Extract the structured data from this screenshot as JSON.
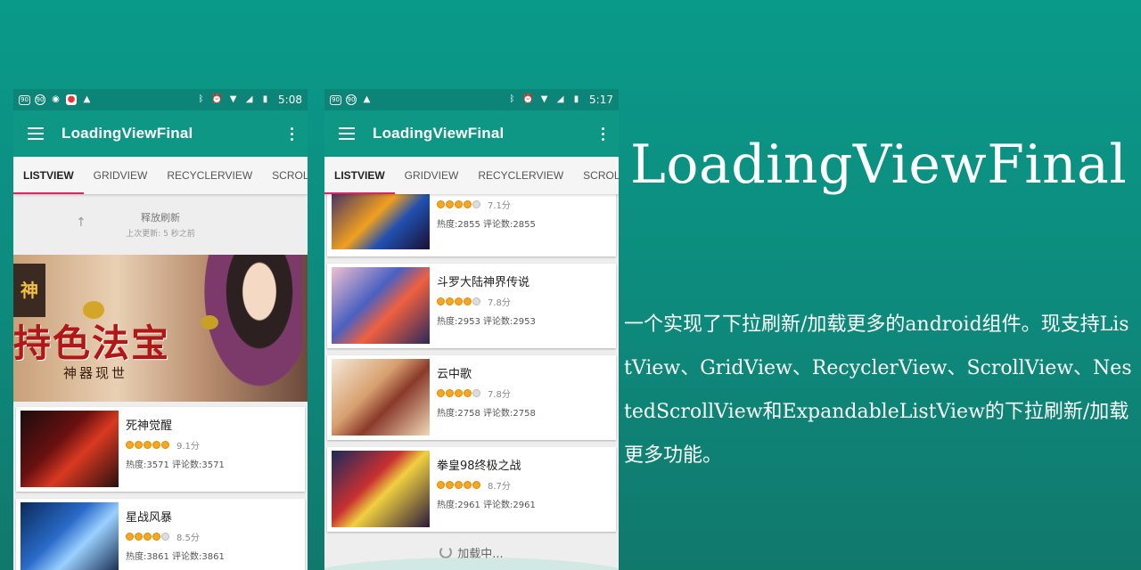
{
  "phone1": {
    "status": {
      "time": "5:08"
    },
    "app_title": "LoadingViewFinal",
    "tabs": [
      "LISTVIEW",
      "GRIDVIEW",
      "RECYCLERVIEW",
      "SCROLL"
    ],
    "refresh": {
      "title": "释放刷新",
      "subtitle": "上次更新: 5 秒之前"
    },
    "banner": {
      "title": "持色法宝",
      "subtitle": "神器现世",
      "corner": "神"
    },
    "items": [
      {
        "title": "死神觉醒",
        "score": "9.1分",
        "stars": 5,
        "stats": "热度:3571  评论数:3571"
      },
      {
        "title": "星战风暴",
        "score": "8.5分",
        "stars": 4,
        "stats": "热度:3861  评论数:3861"
      }
    ]
  },
  "phone2": {
    "status": {
      "time": "5:17"
    },
    "app_title": "LoadingViewFinal",
    "tabs": [
      "LISTVIEW",
      "GRIDVIEW",
      "RECYCLERVIEW",
      "SCROLL"
    ],
    "items": [
      {
        "title": "",
        "score": "7.1分",
        "stars": 4,
        "stats": "热度:2855  评论数:2855"
      },
      {
        "title": "斗罗大陆神界传说",
        "score": "7.8分",
        "stars": 4,
        "stats": "热度:2953  评论数:2953"
      },
      {
        "title": "云中歌",
        "score": "7.8分",
        "stars": 4,
        "stats": "热度:2758  评论数:2758"
      },
      {
        "title": "拳皇98终极之战",
        "score": "8.7分",
        "stars": 5,
        "stats": "热度:2961  评论数:2961"
      }
    ],
    "load_more": "加载中..."
  },
  "headline": "LoadingViewFinal",
  "description": "一个实现了下拉刷新/加载更多的android组件。现支持ListView、GridView、RecyclerView、ScrollView、NestedScrollView和ExpandableListView的下拉刷新/加载更多功能。",
  "colors": {
    "primary": "#0f9786",
    "status_bar": "#0c8478",
    "tab_indicator": "#e91e63",
    "star": "#f5a623"
  }
}
